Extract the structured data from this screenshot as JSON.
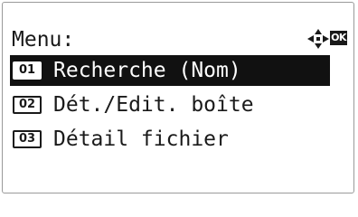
{
  "header": {
    "title": "Menu:",
    "nav_icon": "four-way-arrow-icon",
    "ok_label": "OK"
  },
  "menu": {
    "items": [
      {
        "number": "01",
        "label": "Recherche (Nom)",
        "selected": true
      },
      {
        "number": "02",
        "label": "Dét./Edit. boîte",
        "selected": false
      },
      {
        "number": "03",
        "label": "Détail fichier",
        "selected": false
      }
    ]
  },
  "colors": {
    "selection_background": "#111111",
    "text": "#1a1a1a",
    "background": "#ffffff"
  }
}
